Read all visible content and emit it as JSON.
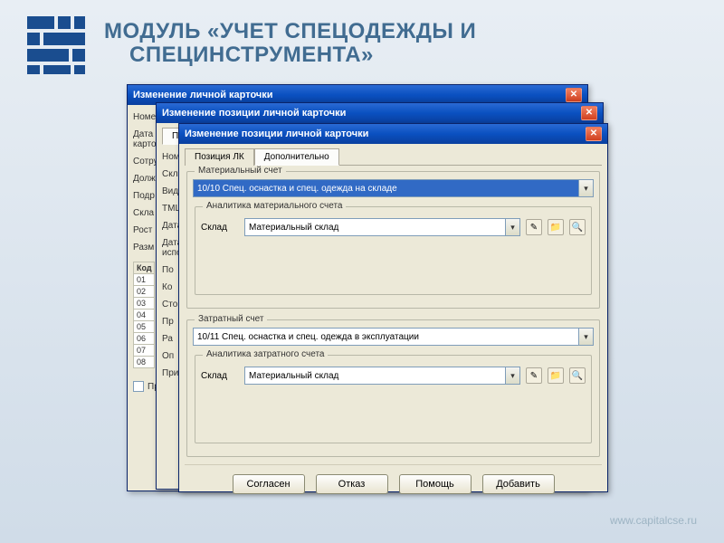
{
  "page": {
    "title_line1": "МОДУЛЬ «УЧЕТ СПЕЦОДЕЖДЫ И",
    "title_line2": "СПЕЦИНСТРУМЕНТА»",
    "footer_url": "www.capitalcse.ru"
  },
  "win1": {
    "title": "Изменение личной карточки",
    "labels": {
      "nom": "Номе",
      "data": "Дата",
      "karto": "карто",
      "sotru": "Сотру",
      "dolj": "Долж",
      "podr": "Подр",
      "sklad": "Скла",
      "rost": "Рост",
      "razm": "Разм",
      "kod": "Код"
    },
    "codes": [
      "01",
      "02",
      "03",
      "04",
      "05",
      "06",
      "07",
      "08"
    ],
    "checkbox": "Пр"
  },
  "win2": {
    "title": "Изменение позиции личной карточки",
    "tab1": "Пози",
    "labels": {
      "nome": "Номе",
      "sklad": "Скла",
      "vido": "Вид о",
      "tmc": "ТМЦ",
      "data": "Дата",
      "datai": "Дата",
      "ispo": "испо",
      "po": "По",
      "ko": "Ко",
      "sto": "Сто",
      "pr": "Пр",
      "ra": "Ра",
      "op": "Оп",
      "pri": "При"
    }
  },
  "win3": {
    "title": "Изменение позиции личной карточки",
    "tabs": {
      "t1": "Позиция ЛК",
      "t2": "Дополнительно"
    },
    "group1": {
      "legend": "Материальный счет",
      "account": "10/10 Спец. оснастка и спец. одежда на складе",
      "sublegend": "Аналитика материального счета",
      "field_label": "Склад",
      "field_value": "Материальный склад"
    },
    "group2": {
      "legend": "Затратный счет",
      "account": "10/11 Спец. оснастка и спец. одежда в эксплуатации",
      "sublegend": "Аналитика затратного счета",
      "field_label": "Склад",
      "field_value": "Материальный склад"
    },
    "buttons": {
      "ok": "Согласен",
      "cancel": "Отказ",
      "help": "Помощь",
      "add": "Добавить"
    }
  },
  "icons": {
    "dd": "▾",
    "close": "✕"
  }
}
